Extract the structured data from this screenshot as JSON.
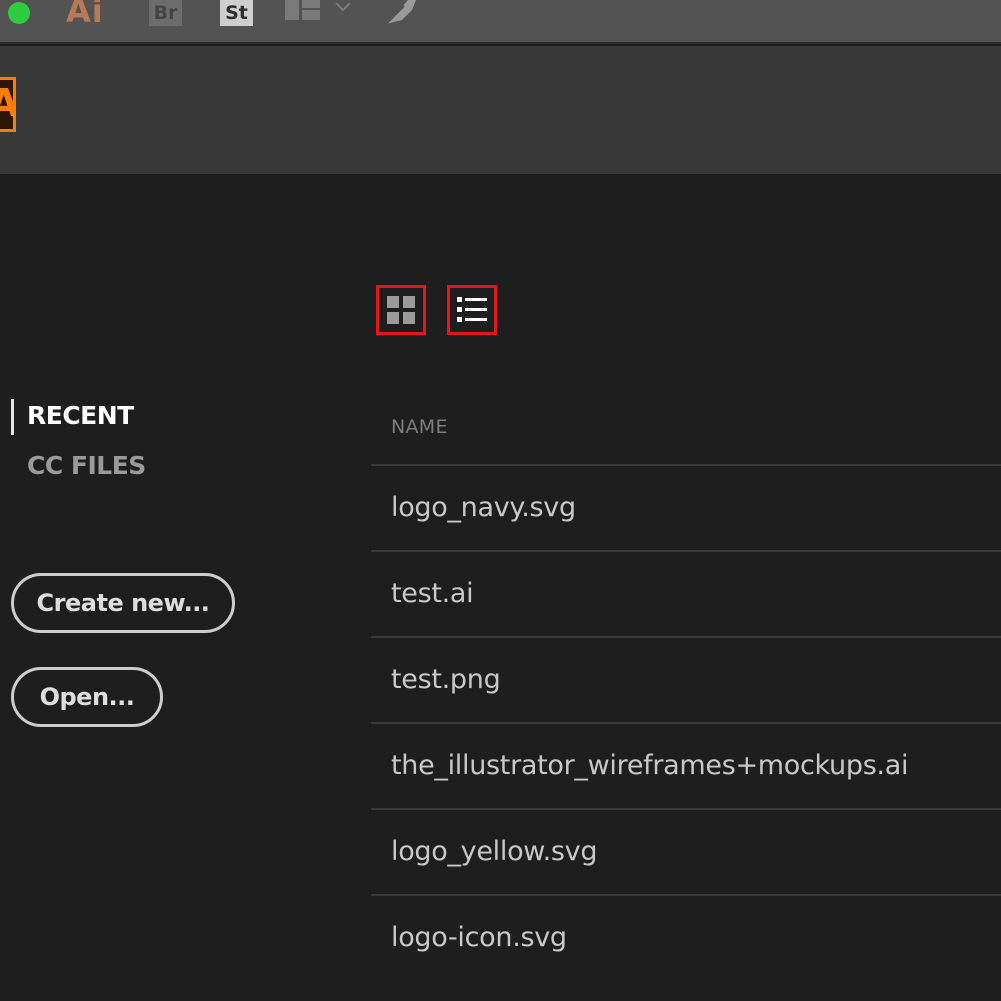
{
  "titlebar": {
    "app_label": "Ai",
    "bridge_label": "Br",
    "stock_label": "St",
    "icons": [
      "window-close-green-icon",
      "workspace-layout-icon",
      "chevron-down-icon",
      "feather-icon"
    ]
  },
  "header": {
    "logo_label": "Ai"
  },
  "sidebar": {
    "items": [
      {
        "label": "RECENT",
        "active": true
      },
      {
        "label": "CC FILES",
        "active": false
      }
    ],
    "create_label": "Create new...",
    "open_label": "Open..."
  },
  "main": {
    "view_modes": [
      "grid-view-icon",
      "list-view-icon"
    ],
    "column_header": "NAME",
    "files": [
      {
        "name": "logo_navy.svg"
      },
      {
        "name": "test.ai"
      },
      {
        "name": "test.png"
      },
      {
        "name": "the_illustrator_wireframes+mockups.ai"
      },
      {
        "name": "logo_yellow.svg"
      },
      {
        "name": "logo-icon.svg"
      }
    ]
  },
  "colors": {
    "accent_orange": "#ff7c00",
    "highlight_red": "#e0171f",
    "background": "#1e1e1e"
  }
}
